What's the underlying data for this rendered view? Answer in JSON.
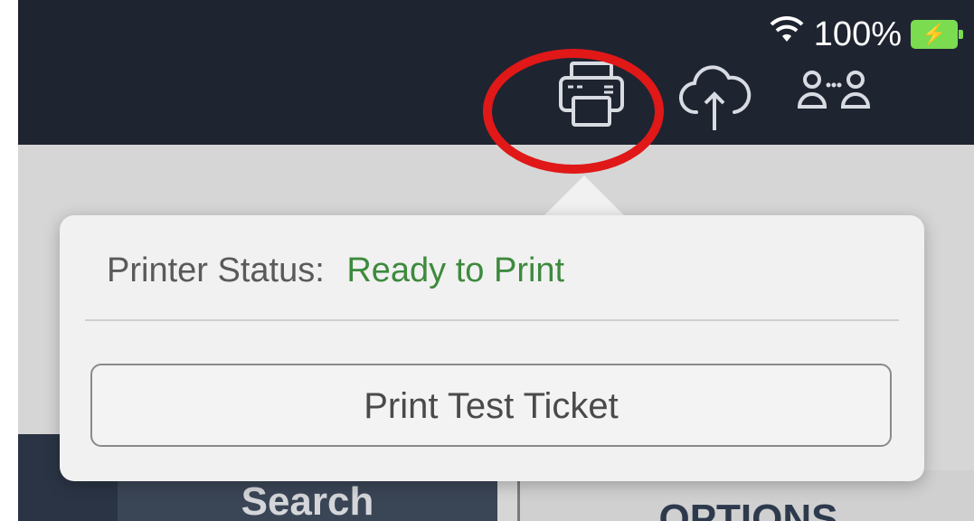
{
  "status_bar": {
    "wifi_icon": "wifi-icon",
    "battery_percent": "100%",
    "battery_icon": "charging-battery-icon"
  },
  "toolbar": {
    "printer_icon": "printer-icon",
    "cloud_upload_icon": "cloud-upload-icon",
    "connected_users_icon": "connected-users-icon"
  },
  "popover": {
    "status_label": "Printer Status:",
    "status_value": "Ready to Print",
    "test_button_label": "Print Test Ticket"
  },
  "bottom": {
    "search_label": "Search",
    "advanced_label": "OPTIONS"
  },
  "colors": {
    "header_bg": "#1f2431",
    "status_ready": "#3d8a3d",
    "highlight_ring": "#e01818",
    "battery_green": "#7cdc50"
  }
}
